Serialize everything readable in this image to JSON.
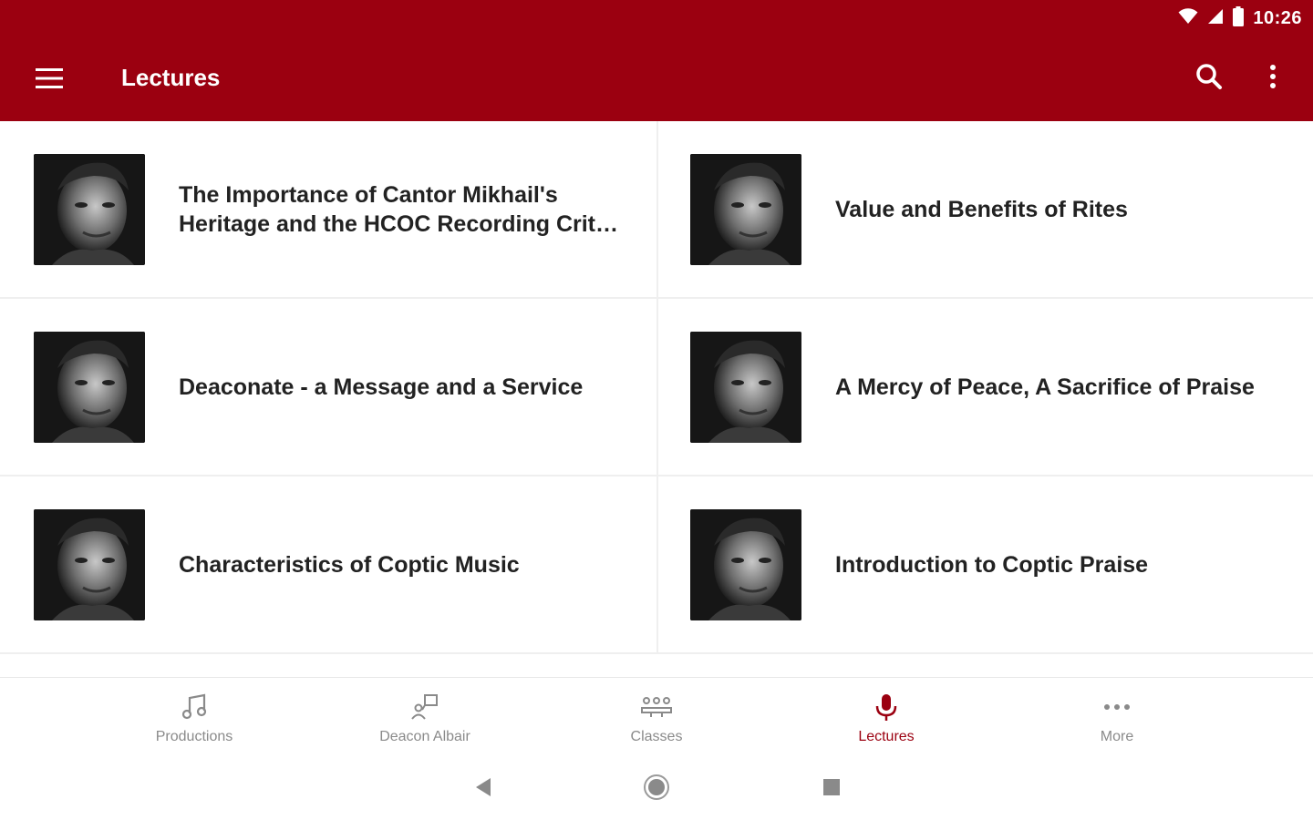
{
  "status_bar": {
    "time": "10:26",
    "icons": [
      "wifi-icon",
      "signal-icon",
      "battery-icon"
    ]
  },
  "app_bar": {
    "title": "Lectures",
    "background_color": "#9b0010",
    "icons": [
      "menu-icon",
      "search-icon",
      "more-vert-icon"
    ]
  },
  "lectures": [
    {
      "title": "The Importance of Cantor Mikhail's Heritage and the HCOC Recording Crit…",
      "thumbnail": "lecturer-portrait"
    },
    {
      "title": "Value and Benefits of Rites",
      "thumbnail": "lecturer-portrait"
    },
    {
      "title": "Deaconate - a Message and a Service",
      "thumbnail": "lecturer-portrait"
    },
    {
      "title": "A Mercy of Peace, A Sacrifice of Praise",
      "thumbnail": "lecturer-portrait"
    },
    {
      "title": "Characteristics of Coptic Music",
      "thumbnail": "lecturer-portrait"
    },
    {
      "title": "Introduction to Coptic Praise",
      "thumbnail": "lecturer-portrait"
    }
  ],
  "bottom_nav": {
    "items": [
      {
        "label": "Productions",
        "icon": "music-note-icon",
        "active": false
      },
      {
        "label": "Deacon Albair",
        "icon": "person-board-icon",
        "active": false
      },
      {
        "label": "Classes",
        "icon": "class-group-icon",
        "active": false
      },
      {
        "label": "Lectures",
        "icon": "microphone-icon",
        "active": true
      },
      {
        "label": "More",
        "icon": "more-horiz-icon",
        "active": false
      }
    ],
    "active_color": "#9b0010",
    "inactive_color": "#8a8a8a"
  },
  "system_nav": {
    "icons": [
      "back-icon",
      "home-icon",
      "recents-icon"
    ]
  }
}
